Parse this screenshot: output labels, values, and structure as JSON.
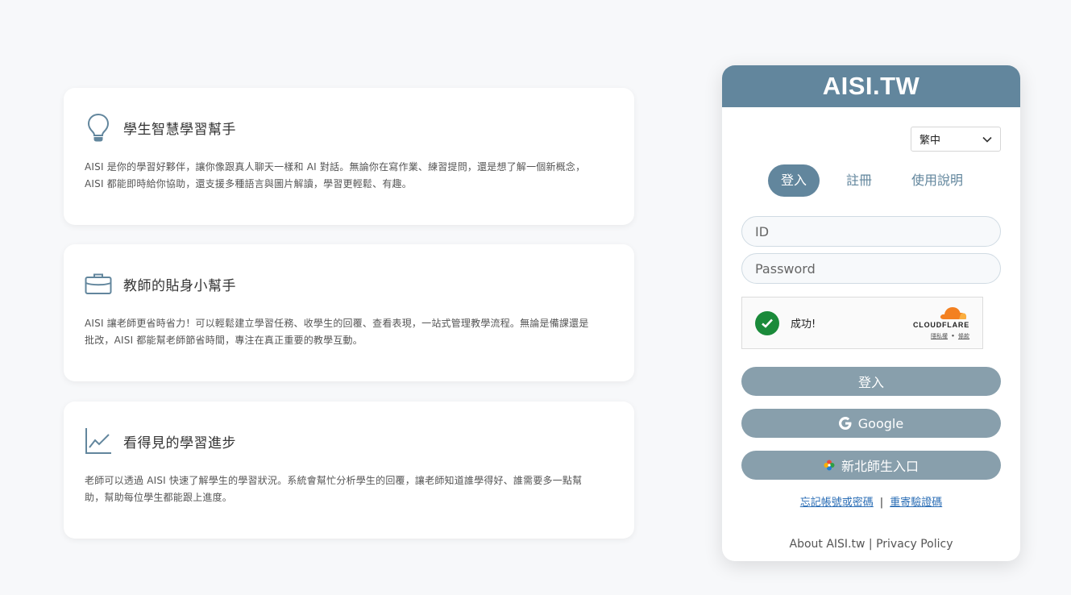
{
  "features": [
    {
      "icon": "lightbulb-icon",
      "title": "學生智慧學習幫手",
      "desc_lines": [
        "AISI 是你的學習好夥伴，讓你像跟真人聊天一樣和 AI 對話。無論你在寫作業、練習提問，還是想了解一個新概念，",
        "AISI 都能即時給你協助，還支援多種語言與圖片解讀，學習更輕鬆、有趣。"
      ]
    },
    {
      "icon": "briefcase-icon",
      "title": "教師的貼身小幫手",
      "desc_lines": [
        "AISI 讓老師更省時省力！可以輕鬆建立學習任務、收學生的回覆、查看表現，一站式管理教學流程。無論是備課還是",
        "批改，AISI 都能幫老師節省時間，專注在真正重要的教學互動。"
      ]
    },
    {
      "icon": "line-chart-icon",
      "title": "看得見的學習進步",
      "desc_lines": [
        "老師可以透過 AISI 快速了解學生的學習狀況。系統會幫忙分析學生的回覆，讓老師知道誰學得好、誰需要多一點幫",
        "助，幫助每位學生都能跟上進度。"
      ]
    }
  ],
  "login": {
    "brand": "AISI.TW",
    "language": "繁中",
    "tabs": [
      "登入",
      "註冊",
      "使用說明"
    ],
    "id_placeholder": "ID",
    "password_placeholder": "Password",
    "captcha": {
      "status": "成功!",
      "provider": "CLOUDFLARE",
      "privacy": "隱私權",
      "separator": "•",
      "terms": "條款"
    },
    "login_button": "登入",
    "google_button": "Google",
    "ntpc_button": "新北師生入口",
    "forgot_link": "忘記帳號或密碼",
    "link_separator": "|",
    "resend_link": "重寄驗證碼",
    "footer_about": "About AISI.tw",
    "footer_separator": "|",
    "footer_privacy": "Privacy Policy"
  },
  "colors": {
    "accent": "#62869d",
    "button": "#889fac",
    "success": "#1a8a3a",
    "link": "#2a6db5",
    "cloudflare_orange": "#f38020"
  }
}
